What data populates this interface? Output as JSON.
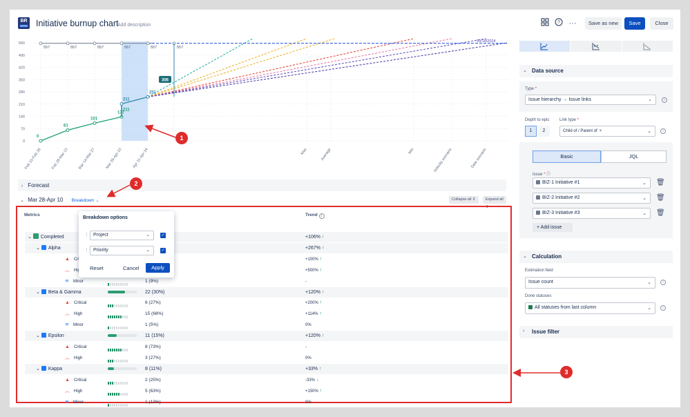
{
  "header": {
    "logo": "BR",
    "title": "Initiative burnup chart",
    "description_link": "Add description",
    "buttons": {
      "save_as_new": "Save as new",
      "save": "Save",
      "close": "Close"
    },
    "icons": [
      "grid-icon",
      "help-icon",
      "more-icon"
    ]
  },
  "chart_data": {
    "type": "line",
    "y_ticks": [
      "560",
      "490",
      "420",
      "350",
      "280",
      "210",
      "140",
      "70",
      "0"
    ],
    "ylim": [
      0,
      560
    ],
    "x_labels": [
      "Feb 15-Feb 26",
      "Feb 29-Mar 13",
      "Mar 14-Mar 27",
      "Mar 28-Apr 10",
      "Apr 11-Apr 24",
      "Max",
      "Average",
      "Min",
      "Velocity scenario",
      "Date scenario"
    ],
    "scope_values": [
      "557",
      "557",
      "557",
      "557",
      "557",
      "557"
    ],
    "scope_top_label": "10/18/2024",
    "completed": [
      {
        "x": "Feb 15-Feb 26",
        "y": 0,
        "label": "0"
      },
      {
        "x": "Feb 29-Mar 13",
        "y": 61,
        "label": "61"
      },
      {
        "x": "Mar 14-Mar 27",
        "y": 101,
        "label": "101"
      },
      {
        "x": "Mar 28-Apr 10",
        "y": 137,
        "label": "137"
      }
    ],
    "in_progress": [
      {
        "x": "Mar 28-Apr 10",
        "y": 211,
        "label": "211"
      },
      {
        "x": "Apr 11-Apr 24",
        "y": 251,
        "label": "251"
      }
    ],
    "projection_label": "306",
    "colors": {
      "scope": "#6b778c",
      "completed": "#1ea076",
      "progress": "#2e86a8",
      "highlight": "#bcd8f7"
    }
  },
  "forecast": {
    "label": "Forecast"
  },
  "period": {
    "label": "Mar 28-Apr 10",
    "breakdown": "Breakdown",
    "collapse_all": "Collapse all",
    "expand_all": "Expand all"
  },
  "table": {
    "col_metrics": "Metrics",
    "col_trend": "Trend",
    "rows": [
      {
        "level": 0,
        "name": "Completed",
        "value": "",
        "trend": "+106%",
        "dir": "up",
        "kind": "completed"
      },
      {
        "level": 1,
        "name": "Alpha",
        "value": "",
        "trend": "+267%",
        "dir": "up",
        "kind": "project"
      },
      {
        "level": 2,
        "name": "Critical",
        "value": "",
        "trend": "+100%",
        "dir": "up",
        "kind": "critical"
      },
      {
        "level": 2,
        "name": "High",
        "value": "",
        "trend": "+500%",
        "dir": "up",
        "kind": "high"
      },
      {
        "level": 2,
        "name": "Minor",
        "value": "1 (9%)",
        "trend": "-",
        "dir": "",
        "kind": "minor",
        "dots": 1
      },
      {
        "level": 1,
        "name": "Beta & Gamma",
        "value": "22 (30%)",
        "trend": "+120%",
        "dir": "up",
        "kind": "project",
        "bar": 0.3
      },
      {
        "level": 2,
        "name": "Critical",
        "value": "6 (27%)",
        "trend": "+200%",
        "dir": "up",
        "kind": "critical",
        "dots": 3
      },
      {
        "level": 2,
        "name": "High",
        "value": "15 (68%)",
        "trend": "+114%",
        "dir": "up",
        "kind": "high",
        "dots": 7
      },
      {
        "level": 2,
        "name": "Minor",
        "value": "1 (5%)",
        "trend": "0%",
        "dir": "",
        "kind": "minor",
        "dots": 1
      },
      {
        "level": 1,
        "name": "Epsilon",
        "value": "11 (15%)",
        "trend": "+120%",
        "dir": "up",
        "kind": "project",
        "bar": 0.15
      },
      {
        "level": 2,
        "name": "Critical",
        "value": "8 (73%)",
        "trend": "-",
        "dir": "",
        "kind": "critical",
        "dots": 7
      },
      {
        "level": 2,
        "name": "High",
        "value": "3 (27%)",
        "trend": "0%",
        "dir": "",
        "kind": "high",
        "dots": 3
      },
      {
        "level": 1,
        "name": "Kappa",
        "value": "8 (11%)",
        "trend": "+33%",
        "dir": "up",
        "kind": "project",
        "bar": 0.11
      },
      {
        "level": 2,
        "name": "Critical",
        "value": "2 (25%)",
        "trend": "-33%",
        "dir": "down",
        "kind": "critical",
        "dots": 3
      },
      {
        "level": 2,
        "name": "High",
        "value": "5 (63%)",
        "trend": "+150%",
        "dir": "up",
        "kind": "high",
        "dots": 6
      },
      {
        "level": 2,
        "name": "Minor",
        "value": "1 (13%)",
        "trend": "0%",
        "dir": "",
        "kind": "minor",
        "dots": 1
      }
    ]
  },
  "breakdown_popup": {
    "title": "Breakdown options",
    "options": [
      "Project",
      "Priority"
    ],
    "reset": "Reset",
    "cancel": "Cancel",
    "apply": "Apply"
  },
  "panel": {
    "data_source": "Data source",
    "type_label": "Type",
    "type_value": "Issue hierarchy → Issue links",
    "depth_label": "Depth to epic",
    "depth_options": [
      "1",
      "2"
    ],
    "link_type_label": "Link type",
    "link_type_value": "Child of / Parent of",
    "tab_basic": "Basic",
    "tab_jql": "JQL",
    "issue_label": "Issue",
    "issues": [
      "BIZ-1 Initiative #1",
      "BIZ-2 Initiative #2",
      "BIZ-3 Initiative #3"
    ],
    "add_issue": "Add issue",
    "calculation": "Calculation",
    "estimation_label": "Estimation field",
    "estimation_value": "Issue count",
    "done_label": "Done statuses",
    "done_value": "All statuses from last column",
    "issue_filter": "Issue filter"
  },
  "callouts": [
    "1",
    "2",
    "3"
  ]
}
